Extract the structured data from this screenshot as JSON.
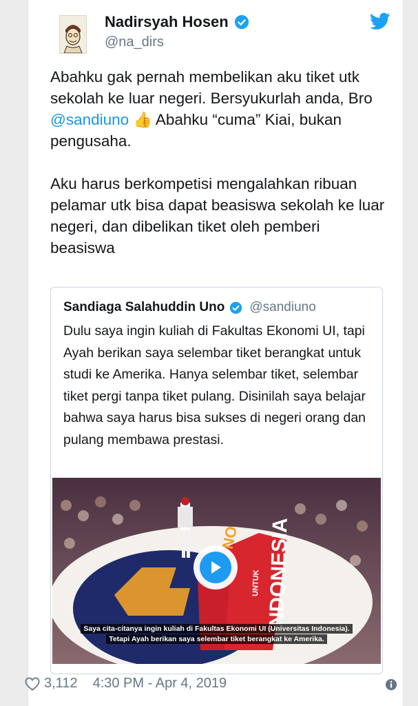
{
  "author": {
    "name": "Nadirsyah Hosen",
    "handle": "@na_dirs"
  },
  "tweet": {
    "p1_a": "Abahku gak pernah membelikan aku tiket utk sekolah ke luar negeri. Bersyukurlah anda, Bro ",
    "p1_mention": "@sandiuno",
    "p1_emoji": "👍",
    "p1_b": " Abahku “cuma” Kiai, bukan pengusaha.",
    "p2": "Aku harus berkompetisi mengalahkan ribuan pelamar utk bisa dapat beasiswa sekolah ke luar negeri, dan dibelikan tiket oleh pemberi beasiswa"
  },
  "quote": {
    "name": "Sandiaga Salahuddin Uno",
    "handle": "@sandiuno",
    "text": "Dulu saya ingin kuliah di Fakultas Ekonomi UI, tapi Ayah berikan saya selembar tiket berangkat untuk studi ke Amerika. Hanya selembar tiket, selembar tiket pergi tanpa tiket pulang. Disinilah saya belajar bahwa saya harus bisa sukses di negeri orang dan pulang membawa prestasi.",
    "video": {
      "subtitle_1": "Saya cita-citanya ingin kuliah di Fakultas Ekonomi UI (Universitas Indonesia).",
      "subtitle_2": "Tetapi Ayah berikan saya selembar tiket berangkat ke Amerika.",
      "stage_text_1": "UNO",
      "stage_text_2": "UNTUK",
      "stage_text_3": "INDONESIA"
    }
  },
  "footer": {
    "likes": "3,112",
    "timestamp": "4:30 PM - Apr 4, 2019"
  },
  "colors": {
    "accent": "#1da1f2",
    "mention": "#1b95e0",
    "muted": "#657786"
  }
}
